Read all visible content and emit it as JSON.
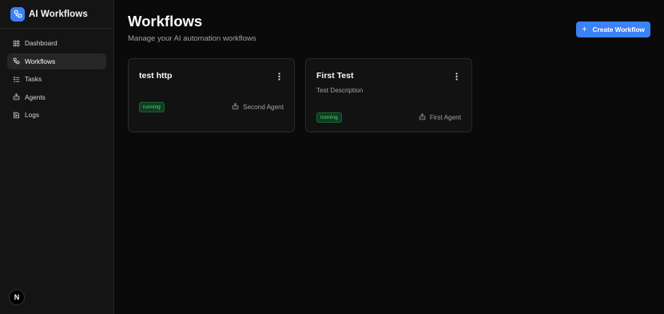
{
  "brand": {
    "title": "AI Workflows",
    "accent": "#3b82f6"
  },
  "sidebar": {
    "items": [
      {
        "label": "Dashboard",
        "icon": "dashboard-icon",
        "active": false
      },
      {
        "label": "Workflows",
        "icon": "workflow-icon",
        "active": true
      },
      {
        "label": "Tasks",
        "icon": "tasks-icon",
        "active": false
      },
      {
        "label": "Agents",
        "icon": "bot-icon",
        "active": false
      },
      {
        "label": "Logs",
        "icon": "logs-icon",
        "active": false
      }
    ],
    "footer_badge": "N"
  },
  "header": {
    "title": "Workflows",
    "subtitle": "Manage your AI automation workflows",
    "create_label": "Create Workflow",
    "create_icon": "plus-icon"
  },
  "workflows": [
    {
      "title": "test http",
      "description": "",
      "status": "running",
      "agent": "Second Agent"
    },
    {
      "title": "First Test",
      "description": "Test Description",
      "status": "running",
      "agent": "First Agent"
    }
  ],
  "colors": {
    "status_running_text": "#4ade80",
    "status_running_bg": "#0f3d1f"
  }
}
